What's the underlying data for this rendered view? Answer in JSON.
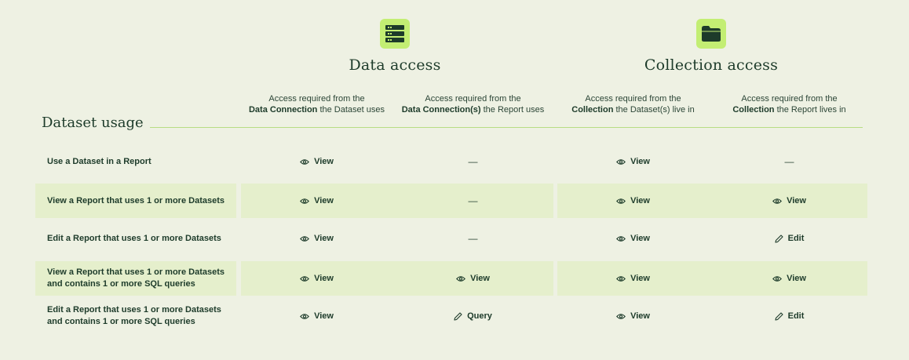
{
  "groups": {
    "data_access": {
      "title": "Data access",
      "icon": "server-icon"
    },
    "collection_access": {
      "title": "Collection access",
      "icon": "folder-icon"
    }
  },
  "columns": [
    {
      "line1": "Access required from the",
      "bold": "Data Connection",
      "rest": " the Dataset uses"
    },
    {
      "line1": "Access required from the",
      "bold": "Data Connection(s)",
      "rest": " the Report uses"
    },
    {
      "line1": "Access required from the",
      "bold": "Collection",
      "rest": " the Dataset(s) live in"
    },
    {
      "line1": "Access required from the",
      "bold": "Collection",
      "rest": " the Report lives in"
    }
  ],
  "section_title": "Dataset usage",
  "rows": [
    {
      "label": [
        "Use a Dataset in a Report"
      ],
      "cells": [
        {
          "type": "view",
          "text": "View"
        },
        {
          "type": "dash",
          "text": "—"
        },
        {
          "type": "view",
          "text": "View"
        },
        {
          "type": "dash",
          "text": "—"
        }
      ]
    },
    {
      "label": [
        "View a Report that uses 1 or more Datasets"
      ],
      "cells": [
        {
          "type": "view",
          "text": "View"
        },
        {
          "type": "dash",
          "text": "—"
        },
        {
          "type": "view",
          "text": "View"
        },
        {
          "type": "view",
          "text": "View"
        }
      ]
    },
    {
      "label": [
        "Edit a Report that uses 1 or more Datasets"
      ],
      "cells": [
        {
          "type": "view",
          "text": "View"
        },
        {
          "type": "dash",
          "text": "—"
        },
        {
          "type": "view",
          "text": "View"
        },
        {
          "type": "edit",
          "text": "Edit"
        }
      ]
    },
    {
      "label": [
        "View a Report that uses 1 or more Datasets",
        "and contains 1 or more SQL queries"
      ],
      "cells": [
        {
          "type": "view",
          "text": "View"
        },
        {
          "type": "view",
          "text": "View"
        },
        {
          "type": "view",
          "text": "View"
        },
        {
          "type": "view",
          "text": "View"
        }
      ]
    },
    {
      "label": [
        "Edit a Report that uses 1 or more Datasets",
        "and contains 1 or more SQL queries"
      ],
      "cells": [
        {
          "type": "view",
          "text": "View"
        },
        {
          "type": "edit",
          "text": "Query"
        },
        {
          "type": "view",
          "text": "View"
        },
        {
          "type": "edit",
          "text": "Edit"
        }
      ]
    }
  ],
  "colors": {
    "background": "#eef1e3",
    "band": "#e5efcc",
    "accent": "#c3ee73",
    "text": "#1d3b2a",
    "rule": "#b7dd83"
  }
}
